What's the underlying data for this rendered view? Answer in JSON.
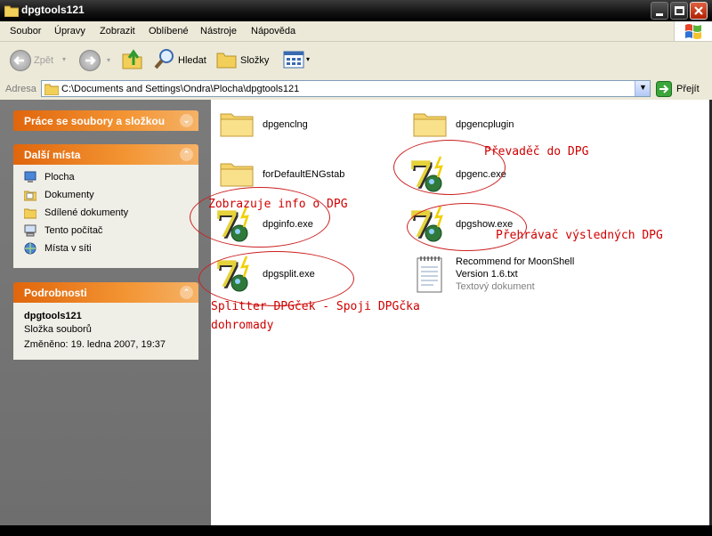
{
  "window": {
    "title": "dpgtools121",
    "minimize_icon": "minimize-icon",
    "maximize_icon": "maximize-icon",
    "close_icon": "close-icon"
  },
  "menu": [
    "Soubor",
    "Úpravy",
    "Zobrazit",
    "Oblíbené",
    "Nástroje",
    "Nápověda"
  ],
  "toolbar": {
    "back": "Zpět",
    "search": "Hledat",
    "folders": "Složky"
  },
  "address": {
    "label": "Adresa",
    "path": "C:\\Documents and Settings\\Ondra\\Plocha\\dpgtools121",
    "go": "Přejít"
  },
  "tasks": {
    "header": "Práce se soubory a složkou"
  },
  "places": {
    "header": "Další místa",
    "items": [
      "Plocha",
      "Dokumenty",
      "Sdílené dokumenty",
      "Tento počítač",
      "Místa v síti"
    ]
  },
  "details": {
    "header": "Podrobnosti",
    "name": "dpgtools121",
    "type": "Složka souborů",
    "modified": "Změněno: 19. ledna 2007, 19:37"
  },
  "files": [
    {
      "name": "dpgenclng",
      "icon": "folder-icon"
    },
    {
      "name": "dpgencplugin",
      "icon": "folder-icon"
    },
    {
      "name": "forDefaultENGstab",
      "icon": "folder-icon"
    },
    {
      "name": "dpgenc.exe",
      "icon": "7zip-exe-icon"
    },
    {
      "name": "dpginfo.exe",
      "icon": "7zip-exe-icon"
    },
    {
      "name": "dpgshow.exe",
      "icon": "7zip-exe-icon"
    },
    {
      "name": "dpgsplit.exe",
      "icon": "7zip-exe-icon"
    },
    {
      "name": "Recommend for MoonShell",
      "line2": "Version 1.6.txt",
      "line3": "Textový dokument",
      "icon": "text-document-icon"
    }
  ],
  "annotations": {
    "prevadec": "Převaděč do DPG",
    "zobrazuje": "Zobrazuje info o DPG",
    "prehravac": "Přehrávač výsledných DPG",
    "splitter_line1": "Splitter DPGček - Spoji DPGčka",
    "splitter_line2": "dohromady"
  }
}
